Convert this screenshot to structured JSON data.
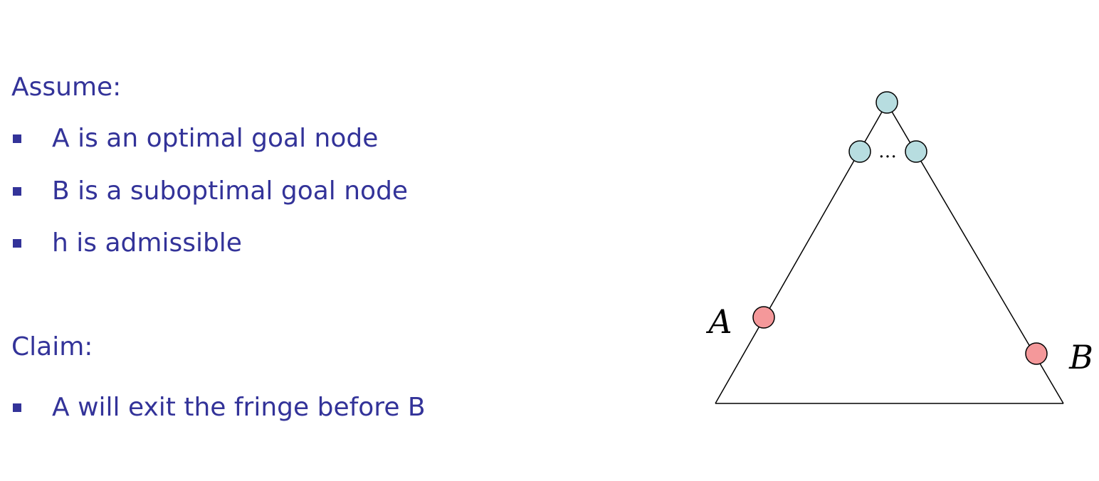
{
  "assume": {
    "heading": "Assume:",
    "items": [
      "A is an optimal goal node",
      "B is a suboptimal goal node",
      "h is admissible"
    ]
  },
  "claim": {
    "heading": "Claim:",
    "items": [
      "A will exit the fringe before B"
    ]
  },
  "diagram": {
    "ellipsis": "…",
    "node_a_label": "A",
    "node_b_label": "B",
    "colors": {
      "text": "#333399",
      "tree_node": "#b7dde0",
      "goal_node": "#f4989a",
      "outline": "#000000"
    }
  }
}
